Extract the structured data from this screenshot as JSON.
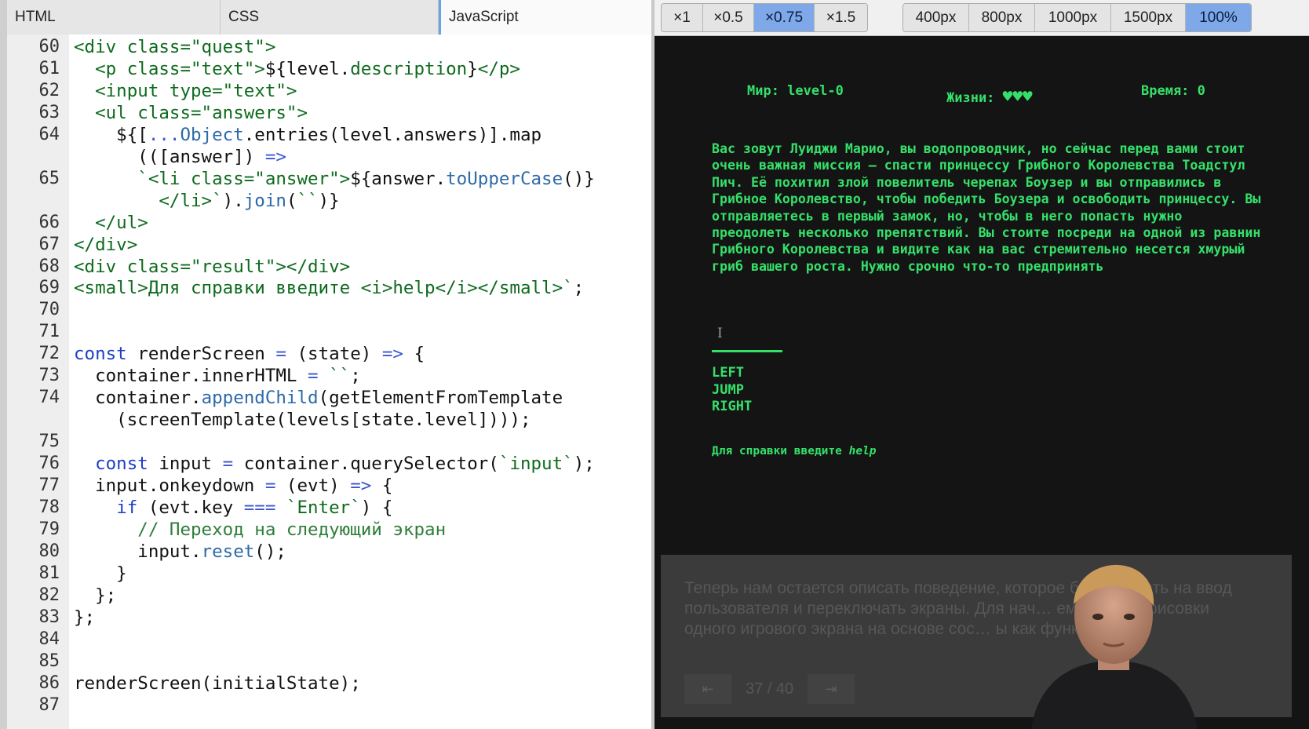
{
  "editor": {
    "tabs": [
      "HTML",
      "CSS",
      "JavaScript"
    ],
    "active_tab": "JavaScript",
    "lines": [
      {
        "n": "60",
        "html": "<span class=\"s\">&lt;div class=\"quest\"&gt;</span>"
      },
      {
        "n": "61",
        "html": "  <span class=\"s\">&lt;p class=\"text\"&gt;</span>${level.<span class=\"s\">description</span>}<span class=\"s\">&lt;/p&gt;</span>"
      },
      {
        "n": "62",
        "html": "  <span class=\"s\">&lt;input type=\"text\"&gt;</span>"
      },
      {
        "n": "63",
        "html": "  <span class=\"s\">&lt;ul class=\"answers\"&gt;</span>"
      },
      {
        "n": "64",
        "html": "    ${[<span class=\"o\">...</span><span class=\"f\">Object</span>.entries(level.answers)].map"
      },
      {
        "n": "",
        "html": "      (([answer]) <span class=\"o\">=&gt;</span>"
      },
      {
        "n": "65",
        "html": "      <span class=\"s\">`&lt;li class=\"answer\"&gt;</span>${answer.<span class=\"f\">toUpperCase</span>()}"
      },
      {
        "n": "",
        "html": "        <span class=\"s\">&lt;/li&gt;`</span>).<span class=\"f\">join</span>(<span class=\"s\">``</span>)}"
      },
      {
        "n": "66",
        "html": "  <span class=\"s\">&lt;/ul&gt;</span>"
      },
      {
        "n": "67",
        "html": "<span class=\"s\">&lt;/div&gt;</span>"
      },
      {
        "n": "68",
        "html": "<span class=\"s\">&lt;div class=\"result\"&gt;&lt;/div&gt;</span>"
      },
      {
        "n": "69",
        "html": "<span class=\"s\">&lt;small&gt;Для справки введите &lt;i&gt;help&lt;/i&gt;&lt;/small&gt;`</span>;"
      },
      {
        "n": "70",
        "html": ""
      },
      {
        "n": "71",
        "html": ""
      },
      {
        "n": "72",
        "html": "<span class=\"k\">const</span> renderScreen <span class=\"o\">=</span> (state) <span class=\"o\">=&gt;</span> {"
      },
      {
        "n": "73",
        "html": "  container.innerHTML <span class=\"o\">=</span> <span class=\"s\">``</span>;"
      },
      {
        "n": "74",
        "html": "  container.<span class=\"f\">appendChild</span>(getElementFromTemplate"
      },
      {
        "n": "",
        "html": "    (screenTemplate(levels[state.level])));"
      },
      {
        "n": "75",
        "html": ""
      },
      {
        "n": "76",
        "html": "  <span class=\"k\">const</span> input <span class=\"o\">=</span> container.querySelector(<span class=\"s\">`input`</span>);"
      },
      {
        "n": "77",
        "html": "  input.onkeydown <span class=\"o\">=</span> (evt) <span class=\"o\">=&gt;</span> {"
      },
      {
        "n": "78",
        "html": "    <span class=\"k\">if</span> (evt.key <span class=\"o\">===</span> <span class=\"s\">`Enter`</span>) {"
      },
      {
        "n": "79",
        "html": "      <span class=\"c\">// Переход на следующий экран</span>"
      },
      {
        "n": "80",
        "html": "      input.<span class=\"f\">reset</span>();"
      },
      {
        "n": "81",
        "html": "    }"
      },
      {
        "n": "82",
        "html": "  };"
      },
      {
        "n": "83",
        "html": "};"
      },
      {
        "n": "84",
        "html": ""
      },
      {
        "n": "85",
        "html": ""
      },
      {
        "n": "86",
        "html": "renderScreen(initialState);"
      },
      {
        "n": "87",
        "html": ""
      }
    ]
  },
  "toolbar": {
    "scale_buttons": [
      "×1",
      "×0.5",
      "×0.75",
      "×1.5"
    ],
    "active_scale": "×0.75",
    "width_buttons": [
      "400px",
      "800px",
      "1000px",
      "1500px",
      "100%"
    ],
    "active_width": "100%"
  },
  "game": {
    "world_label": "Мир: level-0",
    "lives_label": "Жизни:",
    "hearts": "♥♥♥",
    "time_label": "Время: 0",
    "description": "Вас зовут Луиджи Марио, вы водопроводчик, но сейчас перед вами стоит очень важная миссия — спасти принцессу Грибного Королевства Тоадстул Пич. Её похитил злой повелитель черепах Боузер и вы отправились в Грибное Королевство, чтобы победить Боузера и освободить принцессу. Вы отправляетесь в первый замок, но, чтобы в него попасть нужно преодолеть несколько препятствий. Вы стоите посреди на одной из равнин Грибного Королевства и видите как на вас стремительно несется хмурый гриб вашего роста. Нужно срочно что-то предпринять",
    "input_value": "",
    "answers": [
      "LEFT",
      "JUMP",
      "RIGHT"
    ],
    "help_prefix": "Для справки введите ",
    "help_keyword": "help",
    "theme_color": "#35e06a"
  },
  "slide": {
    "text": "Теперь нам остается описать поведение, которое б… тировать на ввод пользователя и переключать экраны. Для нач… ем метод отрисовки одного игрового экрана на основе сос… ы как функцию",
    "prev_icon": "⇤",
    "next_icon": "⇥",
    "counter": "37 / 40"
  }
}
